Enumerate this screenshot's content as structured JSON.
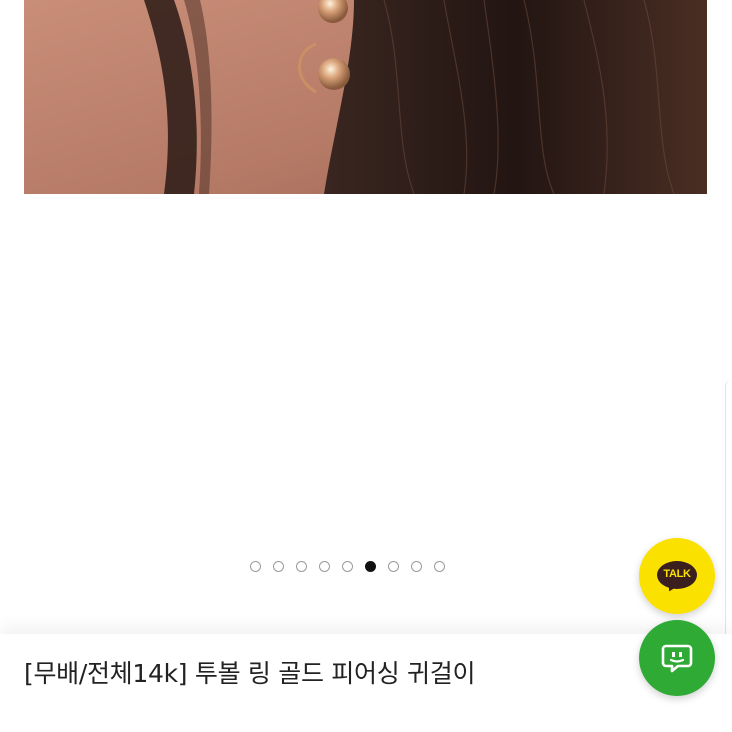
{
  "product": {
    "title": "[무배/전체14k] 투볼 링 골드 피어싱 귀걸이",
    "image": {
      "alt": "gold two-ball ring earring photo"
    }
  },
  "gallery": {
    "total_slides": 9,
    "active_slide": 6
  },
  "floating": {
    "talk_label": "TALK",
    "talk_icon": "kakaotalk-icon",
    "chat_icon": "chat-bubble-icon"
  },
  "colors": {
    "talk_bg": "#fae100",
    "talk_fg": "#3b1e1e",
    "chat_bg": "#2faa35",
    "active_dot": "#111111"
  }
}
